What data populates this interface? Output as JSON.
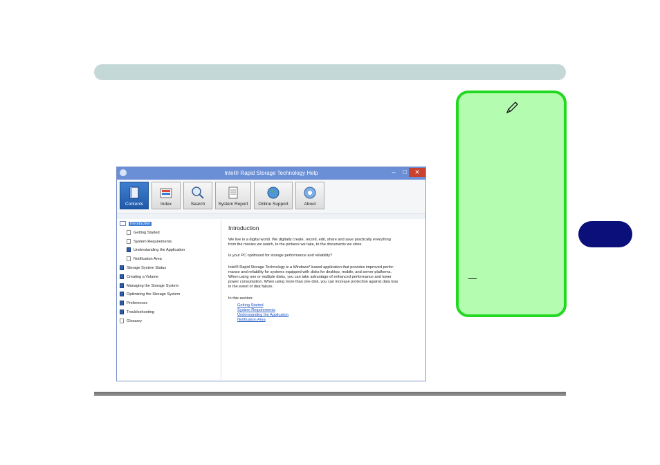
{
  "window": {
    "title": "Intel® Rapid Storage Technology Help",
    "min_glyph": "–",
    "max_glyph": "□",
    "close_glyph": "✕"
  },
  "toolbar": {
    "buttons": [
      {
        "label": "Contents",
        "icon": "book-icon"
      },
      {
        "label": "Index",
        "icon": "index-icon"
      },
      {
        "label": "Search",
        "icon": "magnifier-icon"
      },
      {
        "label": "System Report",
        "icon": "report-icon"
      },
      {
        "label": "Online Support",
        "icon": "globe-icon"
      },
      {
        "label": "About",
        "icon": "about-icon"
      }
    ]
  },
  "nav": {
    "items": [
      {
        "label": "Introduction",
        "selected": true
      },
      {
        "label": "Getting Started"
      },
      {
        "label": "System Requirements"
      },
      {
        "label": "Understanding the Application"
      },
      {
        "label": "Notification Area"
      },
      {
        "label": "Storage System Status"
      },
      {
        "label": "Creating a Volume"
      },
      {
        "label": "Managing the Storage System"
      },
      {
        "label": "Optimizing the Storage System"
      },
      {
        "label": "Preferences"
      },
      {
        "label": "Troubleshooting"
      },
      {
        "label": "Glossary"
      }
    ]
  },
  "content": {
    "heading": "Introduction",
    "p1_line1": "We live in a digital world. We digitally create, record, edit, share and save practically everything",
    "p1_line2": "from the movies we watch, to the pictures we take, to the documents we store.",
    "p2": "Is your PC optimized for storage performance and reliability?",
    "p3_line1": "Intel® Rapid Storage Technology is a Windows*-based application that provides improved perfor-",
    "p3_line2": "mance and reliability for systems equipped with disks for desktop, mobile, and server platforms.",
    "p3_line3": "When using one or multiple disks, you can take advantage of enhanced performance and lower",
    "p3_line4": "power consumption. When using more than one disk, you can increase protection against data loss",
    "p3_line5": "in the event of disk failure.",
    "in_section": "In this section:",
    "links": [
      "Getting Started",
      "System Requirements",
      "Understanding the Application",
      "Notification Area"
    ]
  },
  "colors": {
    "note_bg": "#b4fcb0",
    "note_border": "#22d922",
    "chapter_tab": "#0a0f7a",
    "header_bar": "#c4d8d8",
    "titlebar": "#6b8fd6"
  },
  "icons": {
    "note": "pen-icon"
  }
}
